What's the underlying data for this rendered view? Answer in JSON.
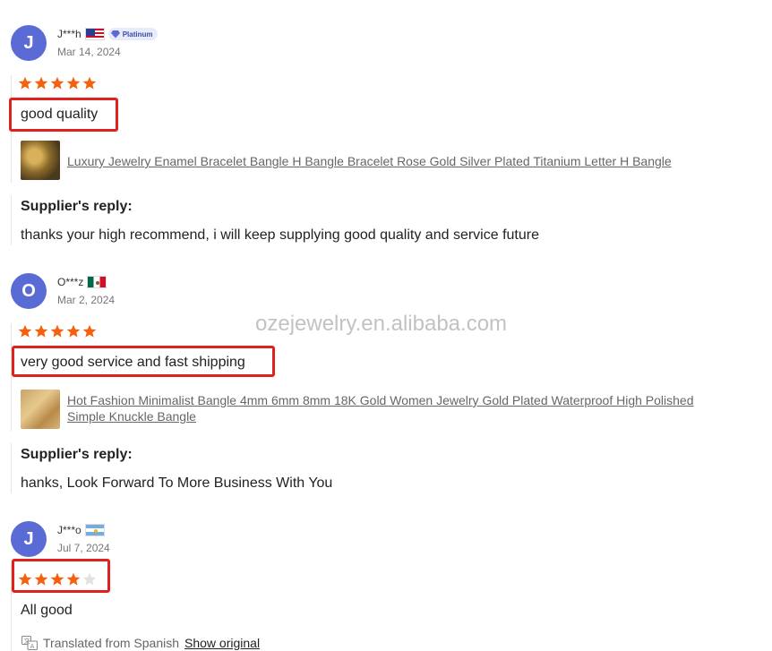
{
  "reviews": [
    {
      "avatar_letter": "J",
      "username": "J***h",
      "flag": "us-flag-icon",
      "badge": "Platinum",
      "date": "Mar 14, 2024",
      "rating": 5,
      "text": "good quality",
      "product": "Luxury Jewelry Enamel Bracelet Bangle H Bangle Bracelet Rose Gold Silver Plated Titanium Letter H Bangle",
      "reply_label": "Supplier's reply:",
      "reply_text": "thanks your high recommend, i will keep supplying good quality and service future"
    },
    {
      "avatar_letter": "O",
      "username": "O***z",
      "flag": "mx-flag-icon",
      "date": "Mar 2, 2024",
      "rating": 5,
      "text": "very good service and fast shipping",
      "product": "Hot Fashion Minimalist Bangle 4mm 6mm 8mm 18K Gold Women Jewelry Gold Plated Waterproof High Polished Simple Knuckle Bangle",
      "reply_label": "Supplier's reply:",
      "reply_text": "hanks, Look Forward To More Business With You"
    },
    {
      "avatar_letter": "J",
      "username": "J***o",
      "flag": "ar-flag-icon",
      "date": "Jul 7, 2024",
      "rating": 4,
      "text": "All good",
      "translated_label": "Translated from Spanish",
      "show_original": "Show original"
    }
  ],
  "watermark": "ozejewelry.en.alibaba.com",
  "colors": {
    "star_filled": "#f5620f",
    "star_empty": "#e2e2e2",
    "highlight_box": "#e0211d",
    "avatar": "#5b6bd6"
  }
}
